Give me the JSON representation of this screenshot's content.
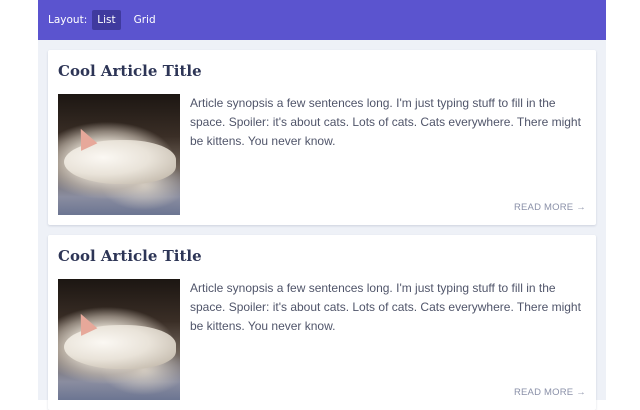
{
  "toolbar": {
    "layout_label": "Layout:",
    "options": [
      {
        "label": "List",
        "active": true
      },
      {
        "label": "Grid",
        "active": false
      }
    ]
  },
  "articles": [
    {
      "title": "Cool Article Title",
      "synopsis": "Article synopsis a few sentences long. I'm just typing stuff to fill in the space. Spoiler: it's about cats. Lots of cats. Cats everywhere. There might be kittens. You never know.",
      "read_more": "READ MORE",
      "read_more_icon": "→",
      "image": "sleeping-white-cat-photo"
    },
    {
      "title": "Cool Article Title",
      "synopsis": "Article synopsis a few sentences long. I'm just typing stuff to fill in the space. Spoiler: it's about cats. Lots of cats. Cats everywhere. There might be kittens. You never know.",
      "read_more": "READ MORE",
      "read_more_icon": "→",
      "image": "sleeping-white-cat-photo"
    }
  ],
  "colors": {
    "header": "#5b54cf",
    "header_active": "#3f3a9e",
    "page_bg": "#eef1f7",
    "title_text": "#2d3556",
    "body_text": "#50556a",
    "link_text": "#8a90a8"
  }
}
